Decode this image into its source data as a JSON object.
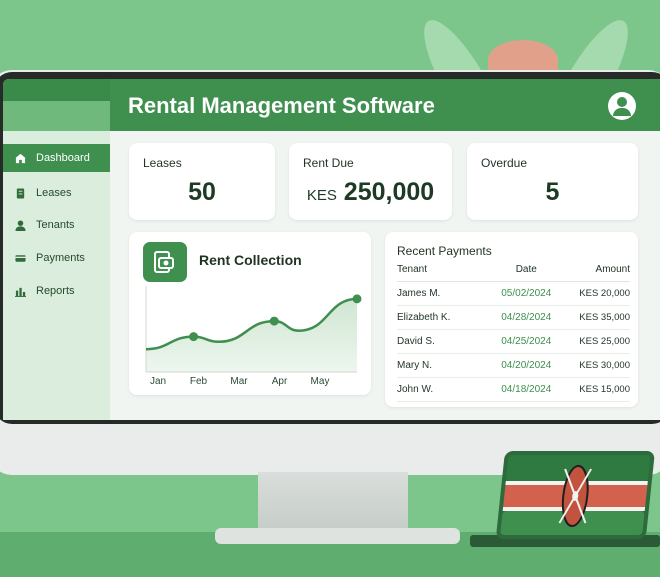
{
  "app": {
    "title": "Rental Management Software"
  },
  "sidebar": {
    "items": [
      {
        "label": "Dashboard",
        "icon": "home-icon",
        "active": true
      },
      {
        "label": "Leases",
        "icon": "document-icon",
        "active": false
      },
      {
        "label": "Tenants",
        "icon": "user-icon",
        "active": false
      },
      {
        "label": "Payments",
        "icon": "card-icon",
        "active": false
      },
      {
        "label": "Reports",
        "icon": "bar-chart-icon",
        "active": false
      }
    ]
  },
  "stats": {
    "leases": {
      "label": "Leases",
      "value": "50"
    },
    "rent_due": {
      "label": "Rent Due",
      "currency": "KES",
      "value": "250,000"
    },
    "overdue": {
      "label": "Overdue",
      "value": "5"
    }
  },
  "rent_collection": {
    "title": "Rent Collection",
    "icon": "house-money-icon"
  },
  "chart_data": {
    "type": "line",
    "title": "Rent Collection",
    "categories": [
      "Jan",
      "Feb",
      "Mar",
      "Apr",
      "May"
    ],
    "series": [
      {
        "values": [
          0.2,
          0.37,
          0.3,
          0.58,
          0.45,
          0.88
        ]
      }
    ],
    "x_positions": [
      0,
      1.15,
      1.75,
      3.1,
      3.7,
      5.1
    ],
    "xlabel": "",
    "ylabel": "",
    "grid": false,
    "legend": "none",
    "color": "#3f8f4f"
  },
  "recent_payments": {
    "title": "Recent Payments",
    "columns": [
      "Tenant",
      "Date",
      "Amount"
    ],
    "rows": [
      {
        "tenant": "James M.",
        "date": "05/02/2024",
        "amount": "KES 20,000"
      },
      {
        "tenant": "Elizabeth K.",
        "date": "04/28/2024",
        "amount": "KES 35,000"
      },
      {
        "tenant": "David S.",
        "date": "04/25/2024",
        "amount": "KES 25,000"
      },
      {
        "tenant": "Mary N.",
        "date": "04/20/2024",
        "amount": "KES 30,000"
      },
      {
        "tenant": "John W.",
        "date": "04/18/2024",
        "amount": "KES 15,000"
      }
    ]
  },
  "colors": {
    "brand": "#3f8f4f",
    "background": "#7cc68c",
    "flag_red": "#d2624e"
  }
}
